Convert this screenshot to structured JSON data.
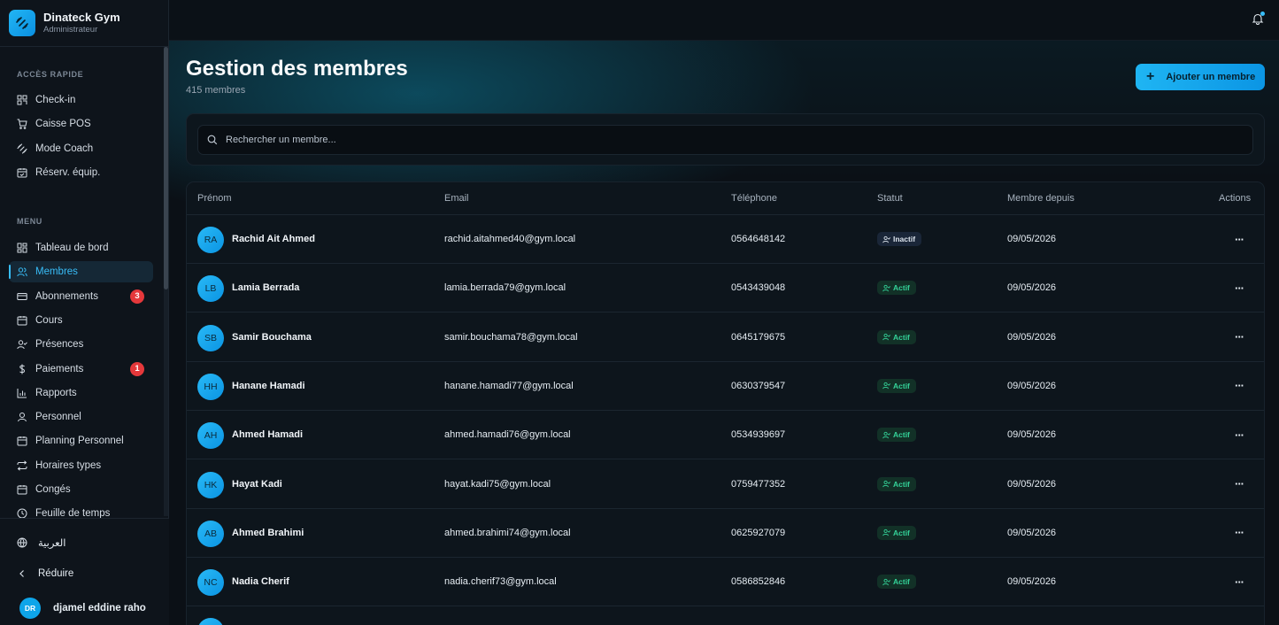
{
  "app": {
    "name": "Dinateck Gym",
    "role": "Administrateur"
  },
  "sidebar": {
    "quick_title": "ACCÈS RAPIDE",
    "quick_items": [
      {
        "label": "Check-in",
        "icon": "grid-scan-icon"
      },
      {
        "label": "Caisse POS",
        "icon": "cart-icon"
      },
      {
        "label": "Mode Coach",
        "icon": "dumbbell-icon"
      },
      {
        "label": "Réserv. équip.",
        "icon": "calendar-check-icon"
      }
    ],
    "menu_title": "MENU",
    "menu_items": [
      {
        "label": "Tableau de bord",
        "icon": "dashboard-icon",
        "active": false,
        "badge": ""
      },
      {
        "label": "Membres",
        "icon": "users-icon",
        "active": true,
        "badge": ""
      },
      {
        "label": "Abonnements",
        "icon": "card-icon",
        "active": false,
        "badge": "3"
      },
      {
        "label": "Cours",
        "icon": "calendar-icon",
        "active": false,
        "badge": ""
      },
      {
        "label": "Présences",
        "icon": "user-check-icon",
        "active": false,
        "badge": ""
      },
      {
        "label": "Paiements",
        "icon": "dollar-icon",
        "active": false,
        "badge": "1"
      },
      {
        "label": "Rapports",
        "icon": "bar-chart-icon",
        "active": false,
        "badge": ""
      },
      {
        "label": "Personnel",
        "icon": "user-icon",
        "active": false,
        "badge": ""
      },
      {
        "label": "Planning Personnel",
        "icon": "calendar-icon",
        "active": false,
        "badge": ""
      },
      {
        "label": "Horaires types",
        "icon": "repeat-icon",
        "active": false,
        "badge": ""
      },
      {
        "label": "Congés",
        "icon": "calendar-icon",
        "active": false,
        "badge": ""
      },
      {
        "label": "Feuille de temps",
        "icon": "clock-icon",
        "active": false,
        "badge": ""
      }
    ],
    "language_label": "العربية",
    "collapse_label": "Réduire",
    "user": {
      "initials": "DR",
      "name": "djamel eddine raho"
    }
  },
  "header": {
    "title": "Gestion des membres",
    "subtitle": "415 membres",
    "add_button": "Ajouter un membre"
  },
  "search": {
    "placeholder": "Rechercher un membre..."
  },
  "table": {
    "columns": [
      "Prénom",
      "Email",
      "Téléphone",
      "Statut",
      "Membre depuis",
      "Actions"
    ],
    "rows": [
      {
        "initials": "RA",
        "name": "Rachid Ait Ahmed",
        "email": "rachid.aitahmed40@gym.local",
        "phone": "0564648142",
        "status": "Inactif",
        "since": "09/05/2026"
      },
      {
        "initials": "LB",
        "name": "Lamia Berrada",
        "email": "lamia.berrada79@gym.local",
        "phone": "0543439048",
        "status": "Actif",
        "since": "09/05/2026"
      },
      {
        "initials": "SB",
        "name": "Samir Bouchama",
        "email": "samir.bouchama78@gym.local",
        "phone": "0645179675",
        "status": "Actif",
        "since": "09/05/2026"
      },
      {
        "initials": "HH",
        "name": "Hanane Hamadi",
        "email": "hanane.hamadi77@gym.local",
        "phone": "0630379547",
        "status": "Actif",
        "since": "09/05/2026"
      },
      {
        "initials": "AH",
        "name": "Ahmed Hamadi",
        "email": "ahmed.hamadi76@gym.local",
        "phone": "0534939697",
        "status": "Actif",
        "since": "09/05/2026"
      },
      {
        "initials": "HK",
        "name": "Hayat Kadi",
        "email": "hayat.kadi75@gym.local",
        "phone": "0759477352",
        "status": "Actif",
        "since": "09/05/2026"
      },
      {
        "initials": "AB",
        "name": "Ahmed Brahimi",
        "email": "ahmed.brahimi74@gym.local",
        "phone": "0625927079",
        "status": "Actif",
        "since": "09/05/2026"
      },
      {
        "initials": "NC",
        "name": "Nadia Cherif",
        "email": "nadia.cherif73@gym.local",
        "phone": "0586852846",
        "status": "Actif",
        "since": "09/05/2026"
      }
    ]
  },
  "colors": {
    "accent": "#38bdf8",
    "active_status": "#34d399",
    "badge": "#e5383b"
  }
}
